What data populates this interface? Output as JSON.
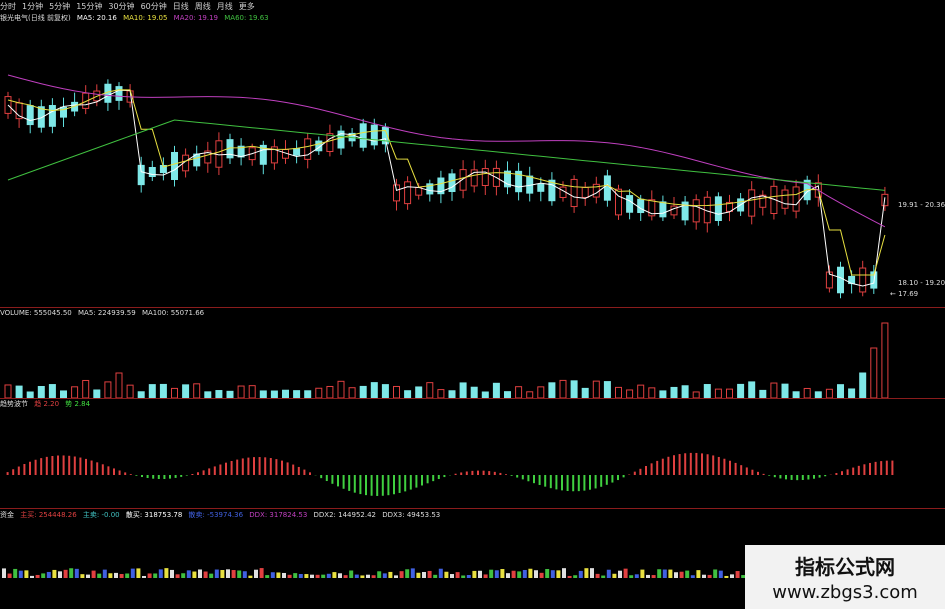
{
  "toolbar": {
    "items": [
      "分时",
      "1分钟",
      "5分钟",
      "15分钟",
      "30分钟",
      "60分钟",
      "日线",
      "周线",
      "月线",
      "更多"
    ]
  },
  "price_panel": {
    "title": "银光电气(日线 前复权)",
    "ma5": "MA5: 20.16",
    "ma10": "MA10: 19.05",
    "ma20": "MA20: 19.19",
    "ma60": "MA60: 19.63",
    "label_range_high": "19.91 - 20.36",
    "label_range_low": "18.10 - 19.20",
    "label_low": "← 17.69",
    "colors": {
      "ma5": "#ffffff",
      "ma10": "#e8e040",
      "ma20": "#c040c0",
      "ma60": "#40c040"
    }
  },
  "volume_panel": {
    "volume": "VOLUME: 555045.50",
    "ma5": "MA5: 224939.59",
    "ma100": "MA100: 55071.66"
  },
  "indicator_panel": {
    "name": "趋势波节",
    "v1": "趋 2.20",
    "v2": "势 2.84"
  },
  "bottom_panel": {
    "name": "资金",
    "main_buy": "主买: 254448.26",
    "main_sell": "主卖: -0.00",
    "scatter_buy": "散买: 318753.78",
    "scatter_sell": "散卖: -53974.36",
    "ddx": "DDX: 317824.53",
    "ddx2": "DDX2: 144952.42",
    "ddx3": "DDX3: 49453.53"
  },
  "watermark": {
    "title": "指标公式网",
    "url": "www.zbgs3.com"
  }
}
